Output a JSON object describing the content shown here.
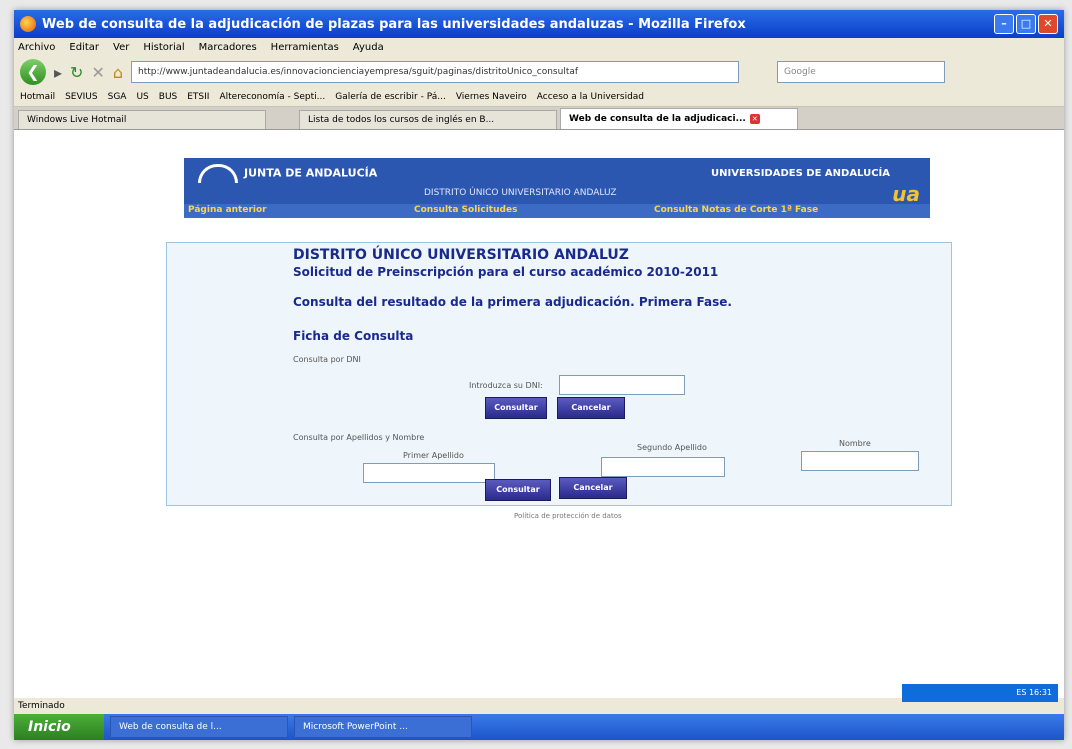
{
  "window": {
    "title": "Web de consulta de la adjudicación de plazas para las universidades andaluzas - Mozilla Firefox"
  },
  "menu": [
    "Archivo",
    "Editar",
    "Ver",
    "Historial",
    "Marcadores",
    "Herramientas",
    "Ayuda"
  ],
  "nav": {
    "url": "http://www.juntadeandalucia.es/innovacioncienciayempresa/sguit/paginas/distritoUnico_consultaf",
    "search_placeholder": "Google"
  },
  "bookmarks": [
    "Hotmail",
    "SEVIUS",
    "SGA",
    "US",
    "BUS",
    "ETSII",
    "Altereconomía - Septi...",
    "Galería de escribir - Pá...",
    "Viernes Naveiro",
    "Acceso a la Universidad"
  ],
  "tabs": [
    "Windows Live Hotmail",
    "Lista de todos los cursos de inglés en B...",
    "Web de consulta de la adjudicaci..."
  ],
  "header": {
    "logo_text": "JUNTA DE ANDALUCÍA",
    "univ_text": "UNIVERSIDADES DE ANDALUCÍA",
    "distrito": "DISTRITO ÚNICO UNIVERSITARIO ANDALUZ",
    "ua": "ua",
    "nav_prev": "Página anterior",
    "nav_sol": "Consulta Solicitudes",
    "nav_notas": "Consulta Notas de Corte 1ª Fase"
  },
  "form": {
    "title": "DISTRITO ÚNICO UNIVERSITARIO ANDALUZ",
    "subtitle": "Solicitud de Preinscripción para el curso académico 2010-2011",
    "result_title": "Consulta del resultado de la primera adjudicación. Primera Fase.",
    "ficha": "Ficha de Consulta",
    "dni_section": "Consulta por DNI",
    "dni_label": "Introduzca su DNI:",
    "consultar": "Consultar",
    "cancelar": "Cancelar",
    "name_section": "Consulta por Apellidos y Nombre",
    "primer_apellido": "Primer Apellido",
    "segundo_apellido": "Segundo Apellido",
    "nombre": "Nombre",
    "footnote": "Política de protección de datos"
  },
  "status": {
    "text": "Terminado",
    "tray": "ES 16:31"
  },
  "taskbar": {
    "start": "Inicio",
    "tasks": [
      "Web de consulta de l...",
      "Microsoft PowerPoint ..."
    ]
  }
}
